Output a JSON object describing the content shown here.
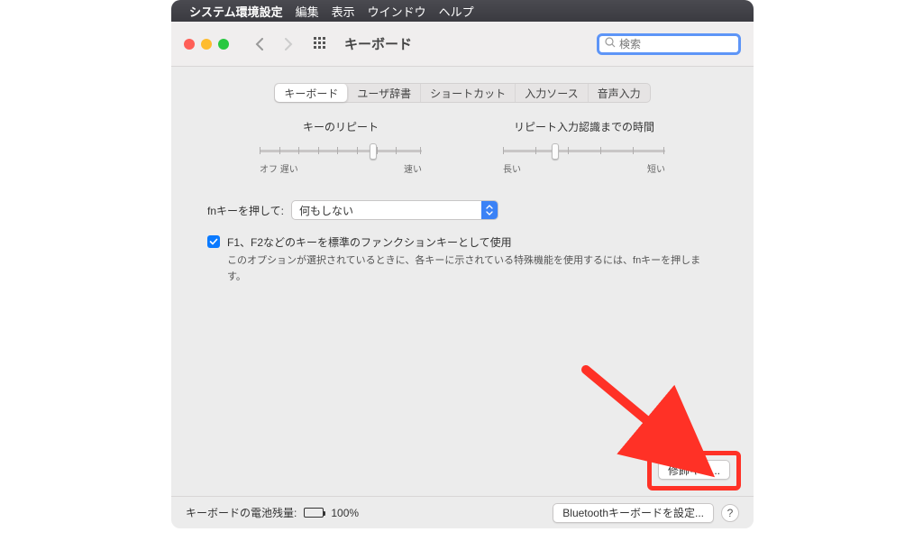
{
  "menubar": {
    "app_name": "システム環境設定",
    "items": [
      "編集",
      "表示",
      "ウインドウ",
      "ヘルプ"
    ]
  },
  "toolbar": {
    "title": "キーボード",
    "search_placeholder": "検索"
  },
  "tabs": [
    "キーボード",
    "ユーザ辞書",
    "ショートカット",
    "入力ソース",
    "音声入力"
  ],
  "slider_repeat": {
    "label": "キーのリピート",
    "left1": "オフ",
    "left2": "遅い",
    "right": "速い",
    "position_pct": 68
  },
  "slider_delay": {
    "label": "リピート入力認識までの時間",
    "left": "長い",
    "right": "短い",
    "position_pct": 30
  },
  "fn_row": {
    "label": "fnキーを押して:",
    "value": "何もしない"
  },
  "checkbox1": {
    "label": "F1、F2などのキーを標準のファンクションキーとして使用",
    "desc": "このオプションが選択されているときに、各キーに示されている特殊機能を使用するには、fnキーを押します。"
  },
  "mod_button": "修飾キー...",
  "footer": {
    "battery_label": "キーボードの電池残量:",
    "battery_pct": "100%",
    "bt_button": "Bluetoothキーボードを設定..."
  }
}
